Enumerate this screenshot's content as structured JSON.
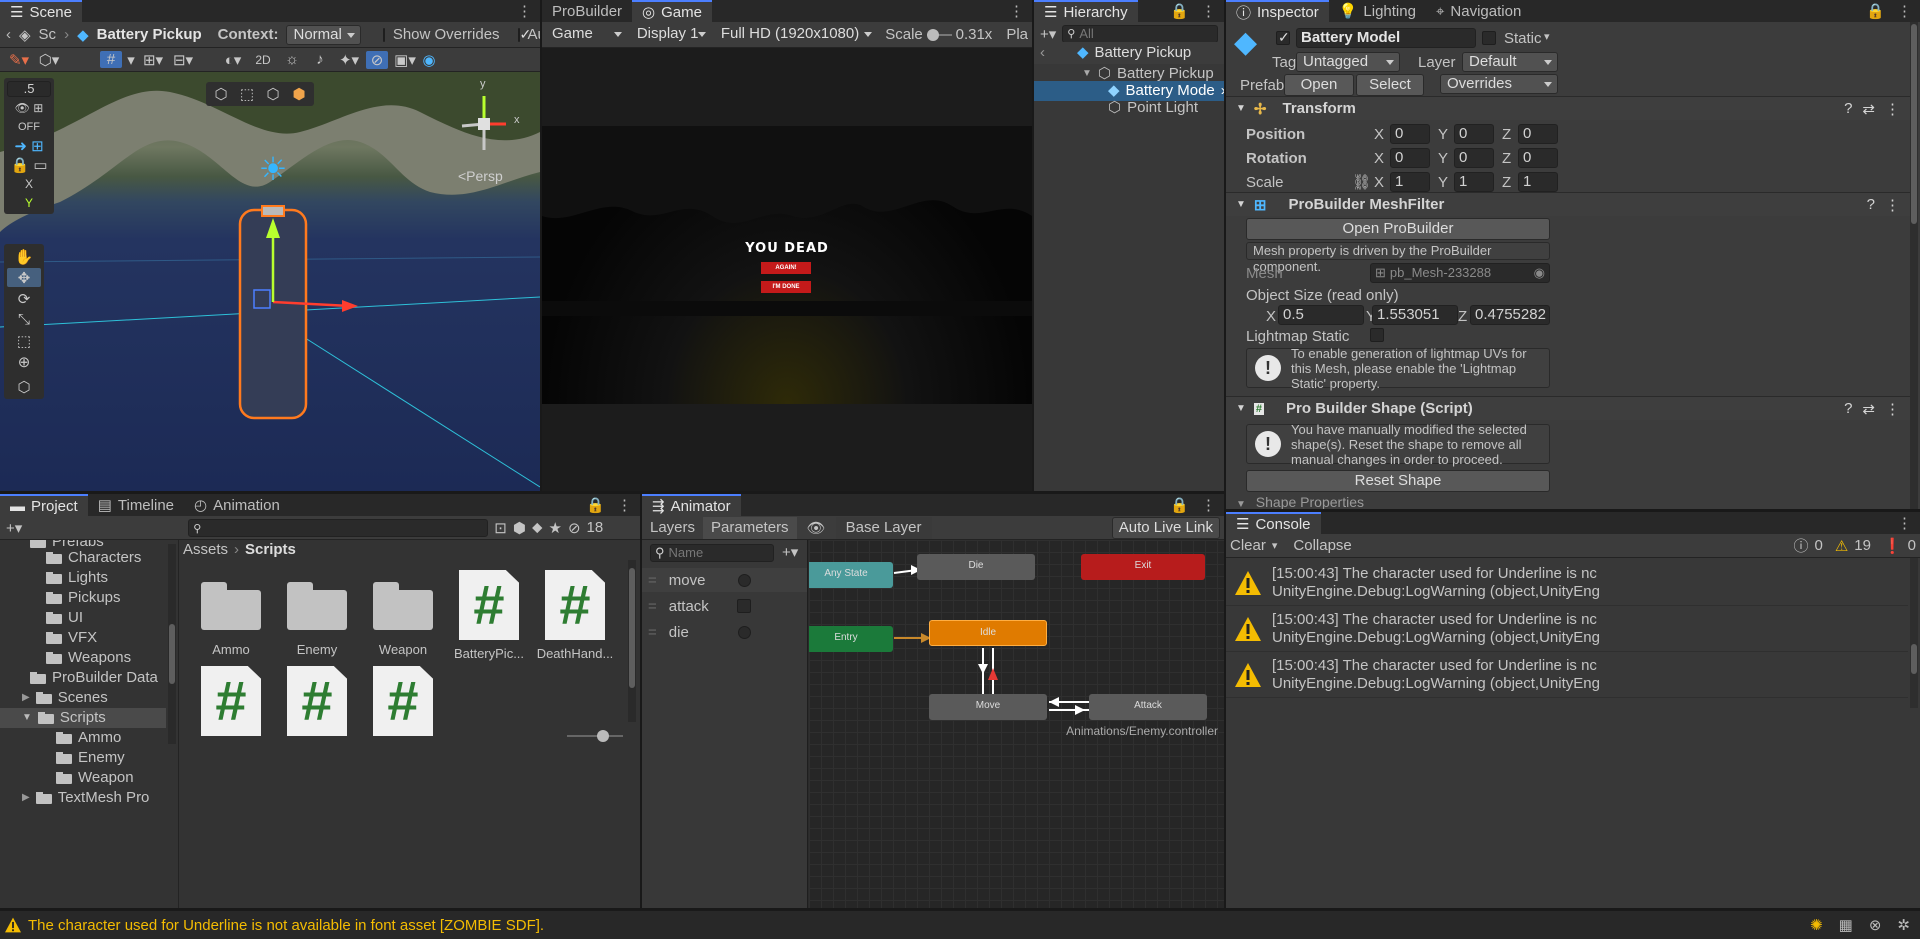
{
  "scene": {
    "tab": "Scene",
    "breadcrumb_root": "Sc",
    "breadcrumb_object": "Battery Pickup",
    "context_label": "Context:",
    "context_value": "Normal",
    "show_overrides": "Show Overrides",
    "auto_save": "Auto Save",
    "snap_value": ".5",
    "off_label": "OFF",
    "two_d": "2D",
    "axis_x": "X",
    "axis_y": "Y",
    "persp": "<Persp",
    "gizmo_y": "y",
    "gizmo_x": "x"
  },
  "game": {
    "tabs": [
      "ProBuilder",
      "Game"
    ],
    "mode": "Game",
    "display": "Display 1",
    "resolution": "Full HD (1920x1080)",
    "scale_label": "Scale",
    "scale_value": "0.31x",
    "play_trunc": "Pla",
    "overlay_title": "YOU DEAD",
    "overlay_btn1": "AGAIN!",
    "overlay_btn2": "I'M DONE"
  },
  "hierarchy": {
    "tab": "Hierarchy",
    "search_placeholder": "All",
    "root": "Battery Pickup",
    "items": [
      "Battery Pickup",
      "Battery Mode",
      "Point Light"
    ]
  },
  "inspector": {
    "tabs": [
      "Inspector",
      "Lighting",
      "Navigation"
    ],
    "object_name": "Battery Model",
    "static_label": "Static",
    "tag_label": "Tag",
    "tag_value": "Untagged",
    "layer_label": "Layer",
    "layer_value": "Default",
    "prefab_label": "Prefab",
    "prefab_open": "Open",
    "prefab_select": "Select",
    "prefab_overrides": "Overrides",
    "transform": {
      "title": "Transform",
      "position_label": "Position",
      "rotation_label": "Rotation",
      "scale_label": "Scale",
      "axes": [
        "X",
        "Y",
        "Z"
      ],
      "position": [
        "0",
        "0",
        "0"
      ],
      "rotation": [
        "0",
        "0",
        "0"
      ],
      "scale": [
        "1",
        "1",
        "1"
      ]
    },
    "meshfilter": {
      "title": "ProBuilder MeshFilter",
      "open_button": "Open ProBuilder",
      "note": "Mesh property is driven by the ProBuilder component.",
      "mesh_label": "Mesh",
      "mesh_value": "pb_Mesh-233288",
      "object_size_label": "Object Size (read only)",
      "size": [
        "0.5",
        "1.553051",
        "0.4755282"
      ],
      "lightmap_label": "Lightmap Static",
      "lightmap_help": "To enable generation of lightmap UVs for this Mesh, please enable the 'Lightmap Static' property."
    },
    "shape": {
      "title": "Pro Builder Shape (Script)",
      "help": "You have manually modified the selected shape(s). Reset the shape to remove all manual changes in order to proceed.",
      "reset_button": "Reset Shape",
      "properties": "Shape Properties"
    }
  },
  "project": {
    "tabs": [
      "Project",
      "Timeline",
      "Animation"
    ],
    "count": "18",
    "breadcrumb": [
      "Assets",
      "Scripts"
    ],
    "tree": [
      "Prefabs",
      "Characters",
      "Lights",
      "Pickups",
      "UI",
      "VFX",
      "Weapons",
      "ProBuilder Data",
      "Scenes",
      "Scripts",
      "Ammo",
      "Enemy",
      "Weapon",
      "TextMesh Pro"
    ],
    "assets": [
      "Ammo",
      "Enemy",
      "Weapon",
      "BatteryPic...",
      "DeathHand..."
    ]
  },
  "animator": {
    "tab": "Animator",
    "subtabs": [
      "Layers",
      "Parameters"
    ],
    "base_layer": "Base Layer",
    "auto_live": "Auto Live Link",
    "name_placeholder": "Name",
    "params": [
      "move",
      "attack",
      "die"
    ],
    "nodes": {
      "any_state": "Any State",
      "die": "Die",
      "exit": "Exit",
      "entry": "Entry",
      "idle": "Idle",
      "move": "Move",
      "attack": "Attack"
    },
    "footer": "Animations/Enemy.controller"
  },
  "console": {
    "tab": "Console",
    "clear": "Clear",
    "collapse": "Collapse",
    "count_info": "0",
    "count_warn": "19",
    "count_err": "0",
    "rows": [
      {
        "line1": "[15:00:43] The character used for Underline is nc",
        "line2": "UnityEngine.Debug:LogWarning (object,UnityEng"
      },
      {
        "line1": "[15:00:43] The character used for Underline is nc",
        "line2": "UnityEngine.Debug:LogWarning (object,UnityEng"
      },
      {
        "line1": "[15:00:43] The character used for Underline is nc",
        "line2": "UnityEngine.Debug:LogWarning (object,UnityEng"
      }
    ]
  },
  "status": {
    "message": "The character used for Underline is not available in font asset [ZOMBIE SDF]."
  },
  "colors": {
    "accent": "#4c7fff",
    "selection": "#2c5d87",
    "warning": "#f4bc02",
    "script_green": "#2e7d32",
    "idle": "#e07b00",
    "exit": "#b71c1c",
    "entry": "#1b7a3a"
  }
}
